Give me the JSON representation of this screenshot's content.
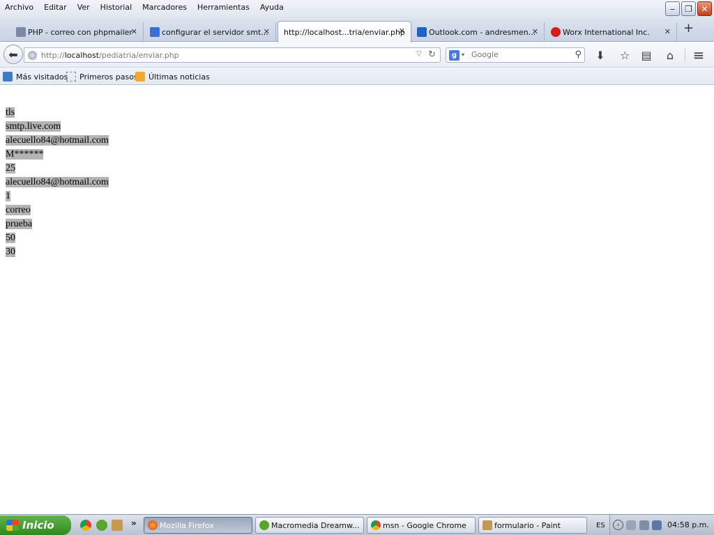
{
  "menubar": {
    "items": [
      {
        "label": "Archivo"
      },
      {
        "label": "Editar"
      },
      {
        "label": "Ver"
      },
      {
        "label": "Historial"
      },
      {
        "label": "Marcadores"
      },
      {
        "label": "Herramientas"
      },
      {
        "label": "Ayuda"
      }
    ],
    "minimize_glyph": "‒",
    "restore_glyph": "❐",
    "close_glyph": "✕"
  },
  "tabs": [
    {
      "label": "PHP - correo con phpmailer",
      "favicon": "code-icon",
      "close": "✕"
    },
    {
      "label": "configurar el servidor smt...",
      "favicon": "google-icon",
      "close": "✕"
    },
    {
      "label": "http://localhost...tria/enviar.php",
      "favicon": "none",
      "close": "✕",
      "active": true
    },
    {
      "label": "Outlook.com - andresmen...",
      "favicon": "outlook-icon",
      "close": "✕"
    },
    {
      "label": "Worx International Inc.",
      "favicon": "worx-icon",
      "close": "✕"
    }
  ],
  "new_tab_glyph": "+",
  "navbar": {
    "back_glyph": "⬅",
    "url_scheme": "http://",
    "url_host": "localhost",
    "url_path": "/pediatria/enviar.php",
    "dropmarker_glyph": "▽",
    "reload_glyph": "↻",
    "search_engine_letter": "g",
    "search_arrow_glyph": "▾",
    "search_placeholder": "Google",
    "search_icon_glyph": "⚲",
    "download_glyph": "⬇",
    "bookmark_glyph": "☆",
    "reading_glyph": "▤",
    "home_glyph": "⌂",
    "menu_glyph": "≡"
  },
  "bookmarks": [
    {
      "label": "Más visitados"
    },
    {
      "label": "Primeros pasos"
    },
    {
      "label": "Últimas noticias"
    }
  ],
  "output_lines": [
    "tls",
    "smtp.live.com",
    "alecuello84@hotmail.com",
    "M******",
    "25",
    "alecuello84@hotmail.com",
    "1",
    "correo",
    "prueba",
    "50",
    "30"
  ],
  "taskbar": {
    "start_label": "Inicio",
    "quicklaunch_more": "»",
    "buttons": [
      {
        "label": "Mozilla Firefox",
        "active": true
      },
      {
        "label": "Macromedia Dreamw..."
      },
      {
        "label": "msn - Google Chrome"
      },
      {
        "label": "formulario - Paint"
      }
    ],
    "language": "ES",
    "tray_arrow": "‹",
    "clock": "04:58 p.m."
  },
  "colors": {
    "selection_highlight": "#b4b4b4",
    "start_button": "#3a9a28"
  }
}
